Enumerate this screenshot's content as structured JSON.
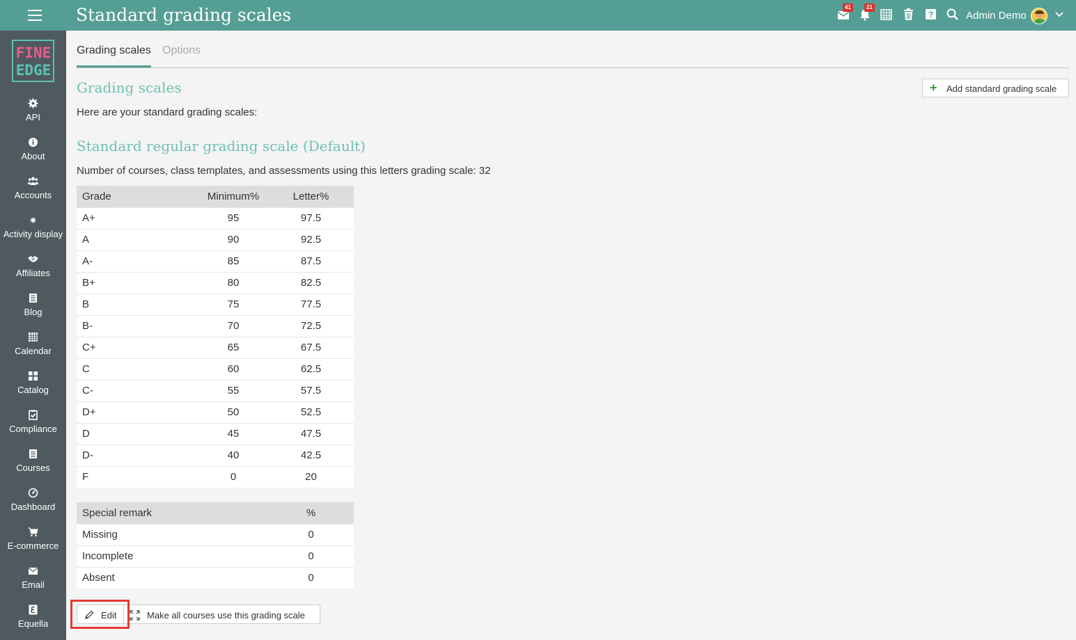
{
  "header": {
    "title": "Standard grading scales",
    "messages_badge": "41",
    "notifications_badge": "21",
    "user_name": "Admin Demo"
  },
  "sidebar": {
    "logo_line1": "FINE",
    "logo_line2": "EDGE",
    "items": [
      {
        "label": "API",
        "icon": "gear-icon"
      },
      {
        "label": "About",
        "icon": "info-icon"
      },
      {
        "label": "Accounts",
        "icon": "users-icon"
      },
      {
        "label": "Activity display",
        "icon": "dot-icon"
      },
      {
        "label": "Affiliates",
        "icon": "handshake-icon"
      },
      {
        "label": "Blog",
        "icon": "document-icon"
      },
      {
        "label": "Calendar",
        "icon": "calendar-icon"
      },
      {
        "label": "Catalog",
        "icon": "grid-icon"
      },
      {
        "label": "Compliance",
        "icon": "checklist-icon"
      },
      {
        "label": "Courses",
        "icon": "courses-icon"
      },
      {
        "label": "Dashboard",
        "icon": "dashboard-icon"
      },
      {
        "label": "E-commerce",
        "icon": "cart-icon"
      },
      {
        "label": "Email",
        "icon": "email-icon"
      },
      {
        "label": "Equella",
        "icon": "equella-icon"
      }
    ]
  },
  "tabs": [
    {
      "label": "Grading scales",
      "active": true
    },
    {
      "label": "Options",
      "active": false
    }
  ],
  "section": {
    "heading": "Grading scales",
    "intro": "Here are your standard grading scales:",
    "add_button": "Add standard grading scale"
  },
  "scale": {
    "title": "Standard regular grading scale (Default)",
    "usage": "Number of courses, class templates, and assessments using this letters grading scale: 32",
    "columns": [
      "Grade",
      "Minimum%",
      "Letter%"
    ],
    "rows": [
      [
        "A+",
        "95",
        "97.5"
      ],
      [
        "A",
        "90",
        "92.5"
      ],
      [
        "A-",
        "85",
        "87.5"
      ],
      [
        "B+",
        "80",
        "82.5"
      ],
      [
        "B",
        "75",
        "77.5"
      ],
      [
        "B-",
        "70",
        "72.5"
      ],
      [
        "C+",
        "65",
        "67.5"
      ],
      [
        "C",
        "60",
        "62.5"
      ],
      [
        "C-",
        "55",
        "57.5"
      ],
      [
        "D+",
        "50",
        "52.5"
      ],
      [
        "D",
        "45",
        "47.5"
      ],
      [
        "D-",
        "40",
        "42.5"
      ],
      [
        "F",
        "0",
        "20"
      ]
    ],
    "remark_columns": [
      "Special remark",
      "%"
    ],
    "remarks": [
      [
        "Missing",
        "0"
      ],
      [
        "Incomplete",
        "0"
      ],
      [
        "Absent",
        "0"
      ]
    ],
    "edit_button": "Edit",
    "make_all_button": "Make all courses use this grading scale"
  },
  "colors": {
    "header": "#559e95",
    "sidebar": "#4e5a5f",
    "accent": "#6fc0b3",
    "badge": "#d9322c",
    "highlight": "#e53935"
  }
}
